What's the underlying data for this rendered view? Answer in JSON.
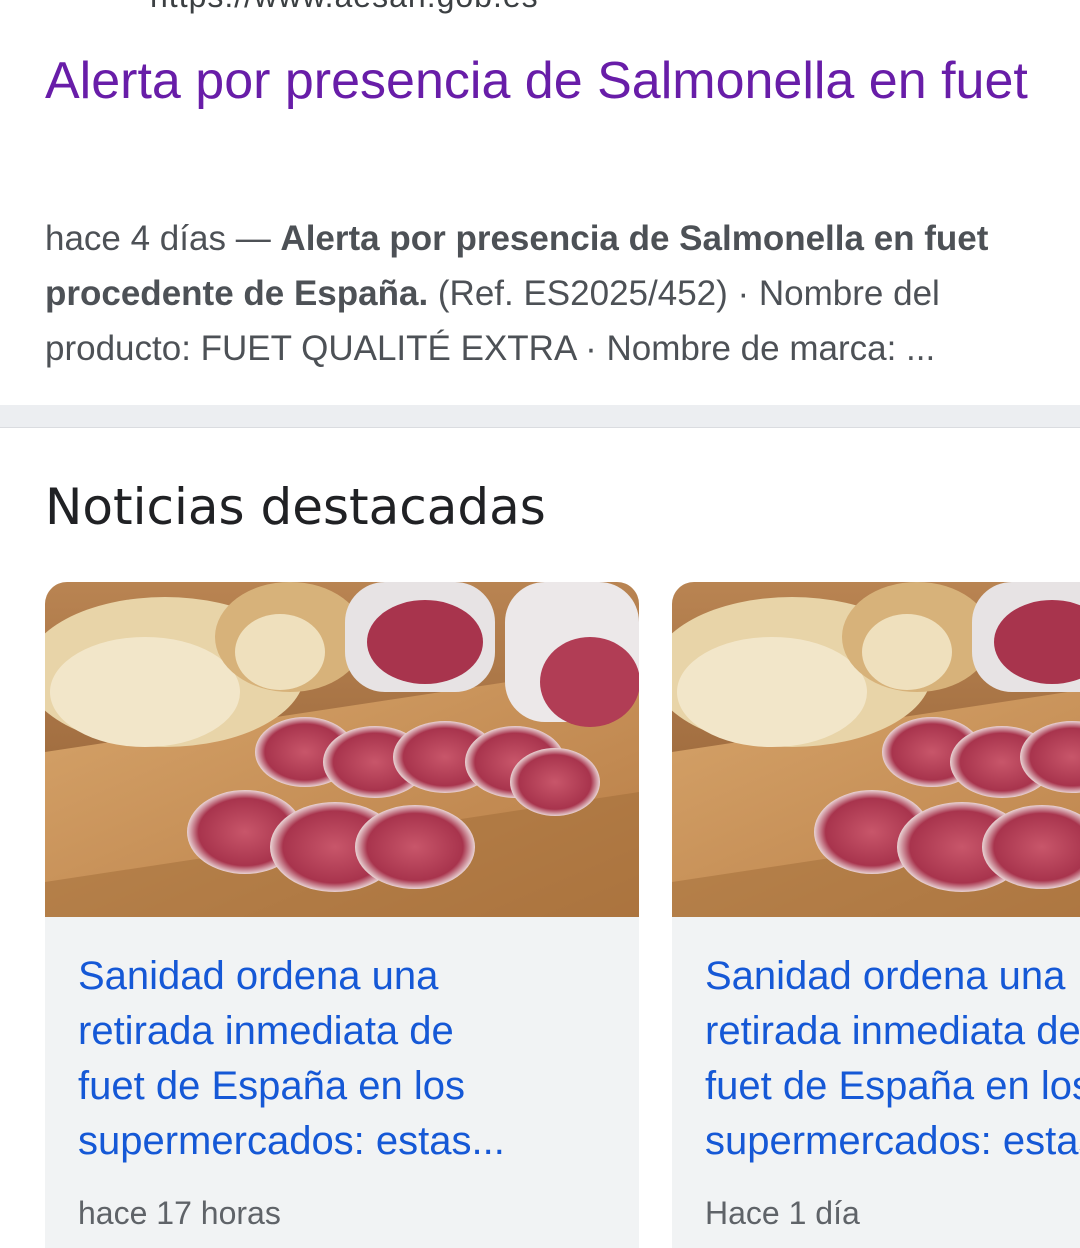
{
  "result": {
    "url_fragment": "https://www.aesan.gob.es",
    "title": "Alerta por presencia de Salmonella en fuet",
    "snippet_date": "hace 4 días",
    "snippet_separator": " — ",
    "snippet_bold": "Alerta por presencia de Salmonella en fuet procedente de España.",
    "snippet_rest": " (Ref. ES2025/452) · Nombre del producto: FUET QUALITÉ EXTRA · Nombre de marca: ..."
  },
  "news": {
    "section_title": "Noticias destacadas",
    "cards": [
      {
        "title_lines": [
          "Sanidad ordena una",
          "retirada inmediata de",
          "fuet de España en los",
          "supermercados: estas..."
        ],
        "time": "hace 17 horas",
        "image": "sliced-fuet-with-bread-photo"
      },
      {
        "title_lines": [
          "Sanidad ordena una",
          "retirada inmediata de",
          "fuet de España en los",
          "supermercados: estas"
        ],
        "time": "Hace 1 día",
        "image": "sliced-fuet-with-bread-photo"
      }
    ]
  },
  "colors": {
    "visited_link": "#681da8",
    "news_link": "#1558d6",
    "snippet_text": "#4d5156",
    "card_bg": "#f1f3f4"
  }
}
